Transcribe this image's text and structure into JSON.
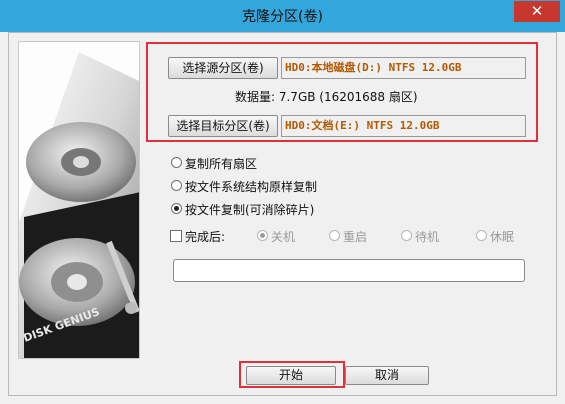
{
  "window": {
    "title": "克隆分区(卷)",
    "close_glyph": "✕"
  },
  "side_image": {
    "brand_text": "DISK GENIUS"
  },
  "source": {
    "button_label": "选择源分区(卷)",
    "value": "HD0:本地磁盘(D:) NTFS 12.0GB"
  },
  "data_size": {
    "label": "数据量: 7.7GB (16201688 扇区)"
  },
  "target": {
    "button_label": "选择目标分区(卷)",
    "value": "HD0:文档(E:) NTFS 12.0GB"
  },
  "copy_mode": {
    "options": [
      "复制所有扇区",
      "按文件系统结构原样复制",
      "按文件复制(可消除碎片)"
    ],
    "selected": 2
  },
  "after_completion": {
    "label": "完成后:",
    "checked": false,
    "options": [
      "关机",
      "重启",
      "待机",
      "休眠"
    ],
    "selected": 0
  },
  "path_box": {
    "value": ""
  },
  "footer": {
    "start_label": "开始",
    "cancel_label": "取消"
  },
  "colors": {
    "titlebar": "#33a6dc",
    "highlight": "#e0303a",
    "field_text": "#b35a00",
    "close": "#c7372f"
  }
}
